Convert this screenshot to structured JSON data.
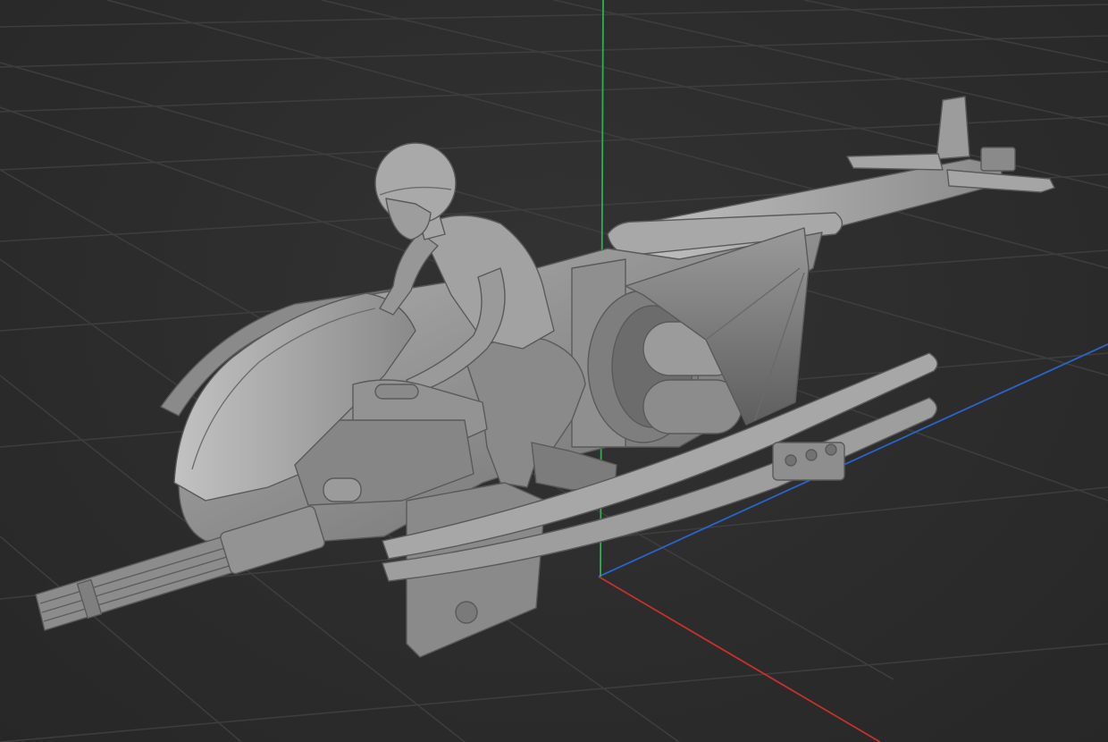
{
  "viewport": {
    "kind": "3d-viewport",
    "shading": "solid",
    "background_color": "#2e2e2e",
    "grid_color": "#3c3c3c",
    "axis_colors": {
      "x": "#c9302c",
      "y": "#2a63c9",
      "z": "#2fae55"
    }
  },
  "model": {
    "description_icon": "hoverbike-with-rider-icon",
    "material_color": "#8c8c8c"
  }
}
